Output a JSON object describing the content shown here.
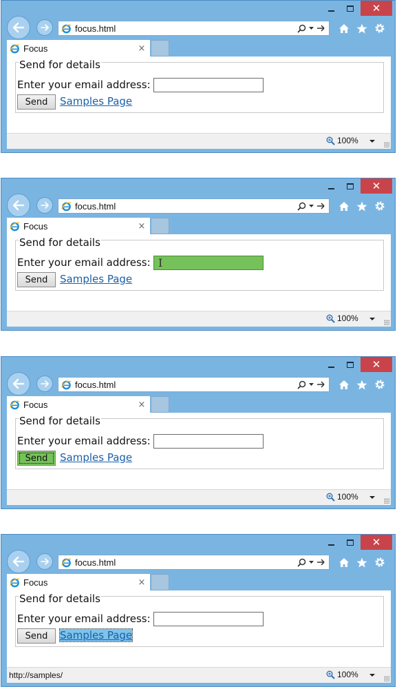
{
  "browser": {
    "address": "focus.html",
    "tab_title": "Focus",
    "tab_close": "×",
    "zoom": "100%",
    "close_glyph": "✕"
  },
  "form": {
    "legend": "Send for details",
    "email_label": "Enter your email address:",
    "email_value": "",
    "send_label": "Send",
    "link_label": "Samples Page"
  },
  "screens": [
    {
      "focus": "none",
      "status_text": ""
    },
    {
      "focus": "email-input",
      "status_text": ""
    },
    {
      "focus": "send-button",
      "status_text": ""
    },
    {
      "focus": "samples-link",
      "status_text": "http://samples/"
    }
  ],
  "colors": {
    "frame": "#7ab5e2",
    "focus_fill": "#76c25a",
    "link_focus_fill": "#7ec3ea",
    "close_button": "#c9444a"
  }
}
